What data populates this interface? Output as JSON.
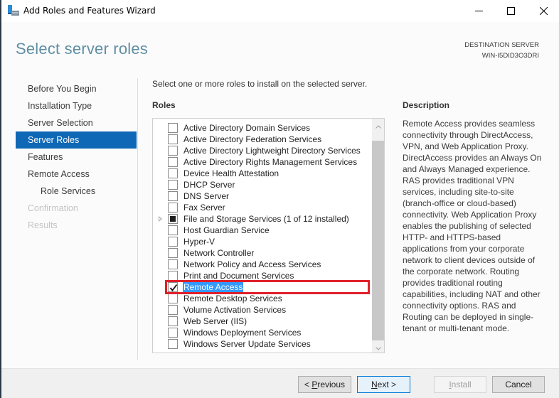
{
  "window": {
    "title": "Add Roles and Features Wizard",
    "icon": "server-manager-icon",
    "controls": {
      "minimize": "minimize-icon",
      "maximize": "maximize-icon",
      "close": "close-icon"
    }
  },
  "header": {
    "page_title": "Select server roles",
    "destination_label": "DESTINATION SERVER",
    "destination_server": "WIN-I5DID3O3DRI"
  },
  "nav": {
    "items": [
      {
        "label": "Before You Begin",
        "state": "normal"
      },
      {
        "label": "Installation Type",
        "state": "normal"
      },
      {
        "label": "Server Selection",
        "state": "normal"
      },
      {
        "label": "Server Roles",
        "state": "active"
      },
      {
        "label": "Features",
        "state": "normal"
      },
      {
        "label": "Remote Access",
        "state": "normal"
      },
      {
        "label": "Role Services",
        "state": "sub"
      },
      {
        "label": "Confirmation",
        "state": "disabled"
      },
      {
        "label": "Results",
        "state": "disabled"
      }
    ]
  },
  "main": {
    "instruction": "Select one or more roles to install on the selected server.",
    "roles_label": "Roles",
    "roles": [
      {
        "label": "Active Directory Domain Services",
        "state": "unchecked"
      },
      {
        "label": "Active Directory Federation Services",
        "state": "unchecked"
      },
      {
        "label": "Active Directory Lightweight Directory Services",
        "state": "unchecked"
      },
      {
        "label": "Active Directory Rights Management Services",
        "state": "unchecked"
      },
      {
        "label": "Device Health Attestation",
        "state": "unchecked"
      },
      {
        "label": "DHCP Server",
        "state": "unchecked"
      },
      {
        "label": "DNS Server",
        "state": "unchecked"
      },
      {
        "label": "Fax Server",
        "state": "unchecked"
      },
      {
        "label": "File and Storage Services (1 of 12 installed)",
        "state": "partial",
        "expandable": true
      },
      {
        "label": "Host Guardian Service",
        "state": "unchecked"
      },
      {
        "label": "Hyper-V",
        "state": "unchecked"
      },
      {
        "label": "Network Controller",
        "state": "unchecked"
      },
      {
        "label": "Network Policy and Access Services",
        "state": "unchecked"
      },
      {
        "label": "Print and Document Services",
        "state": "unchecked"
      },
      {
        "label": "Remote Access",
        "state": "checked",
        "selected": true,
        "highlighted": true
      },
      {
        "label": "Remote Desktop Services",
        "state": "unchecked"
      },
      {
        "label": "Volume Activation Services",
        "state": "unchecked"
      },
      {
        "label": "Web Server (IIS)",
        "state": "unchecked"
      },
      {
        "label": "Windows Deployment Services",
        "state": "unchecked"
      },
      {
        "label": "Windows Server Update Services",
        "state": "unchecked"
      }
    ],
    "scroll_position": "top",
    "highlight_color": "#e0202a"
  },
  "description": {
    "label": "Description",
    "lines": [
      "Remote Access provides seamless",
      "connectivity through DirectAccess,",
      "VPN, and Web Application Proxy.",
      "DirectAccess provides an Always On",
      "and Always Managed experience.",
      "RAS provides traditional VPN",
      "services, including site-to-site",
      "(branch-office or cloud-based)",
      "connectivity. Web Application Proxy",
      "enables the publishing of selected",
      "HTTP- and HTTPS-based",
      "applications from your corporate",
      "network to client devices outside of",
      "the corporate network. Routing",
      "provides traditional routing",
      "capabilities, including NAT and other",
      "connectivity options. RAS and",
      "Routing can be deployed in single-",
      "tenant or multi-tenant mode."
    ]
  },
  "footer": {
    "previous": {
      "prefix": "< ",
      "accel": "P",
      "rest": "revious"
    },
    "next": {
      "accel": "N",
      "rest": "ext >"
    },
    "install": {
      "accel": "I",
      "rest": "nstall",
      "enabled": false
    },
    "cancel": "Cancel"
  },
  "colors": {
    "accent": "#0f68b5",
    "title": "#5f8ea3",
    "selection": "#3399ff"
  }
}
